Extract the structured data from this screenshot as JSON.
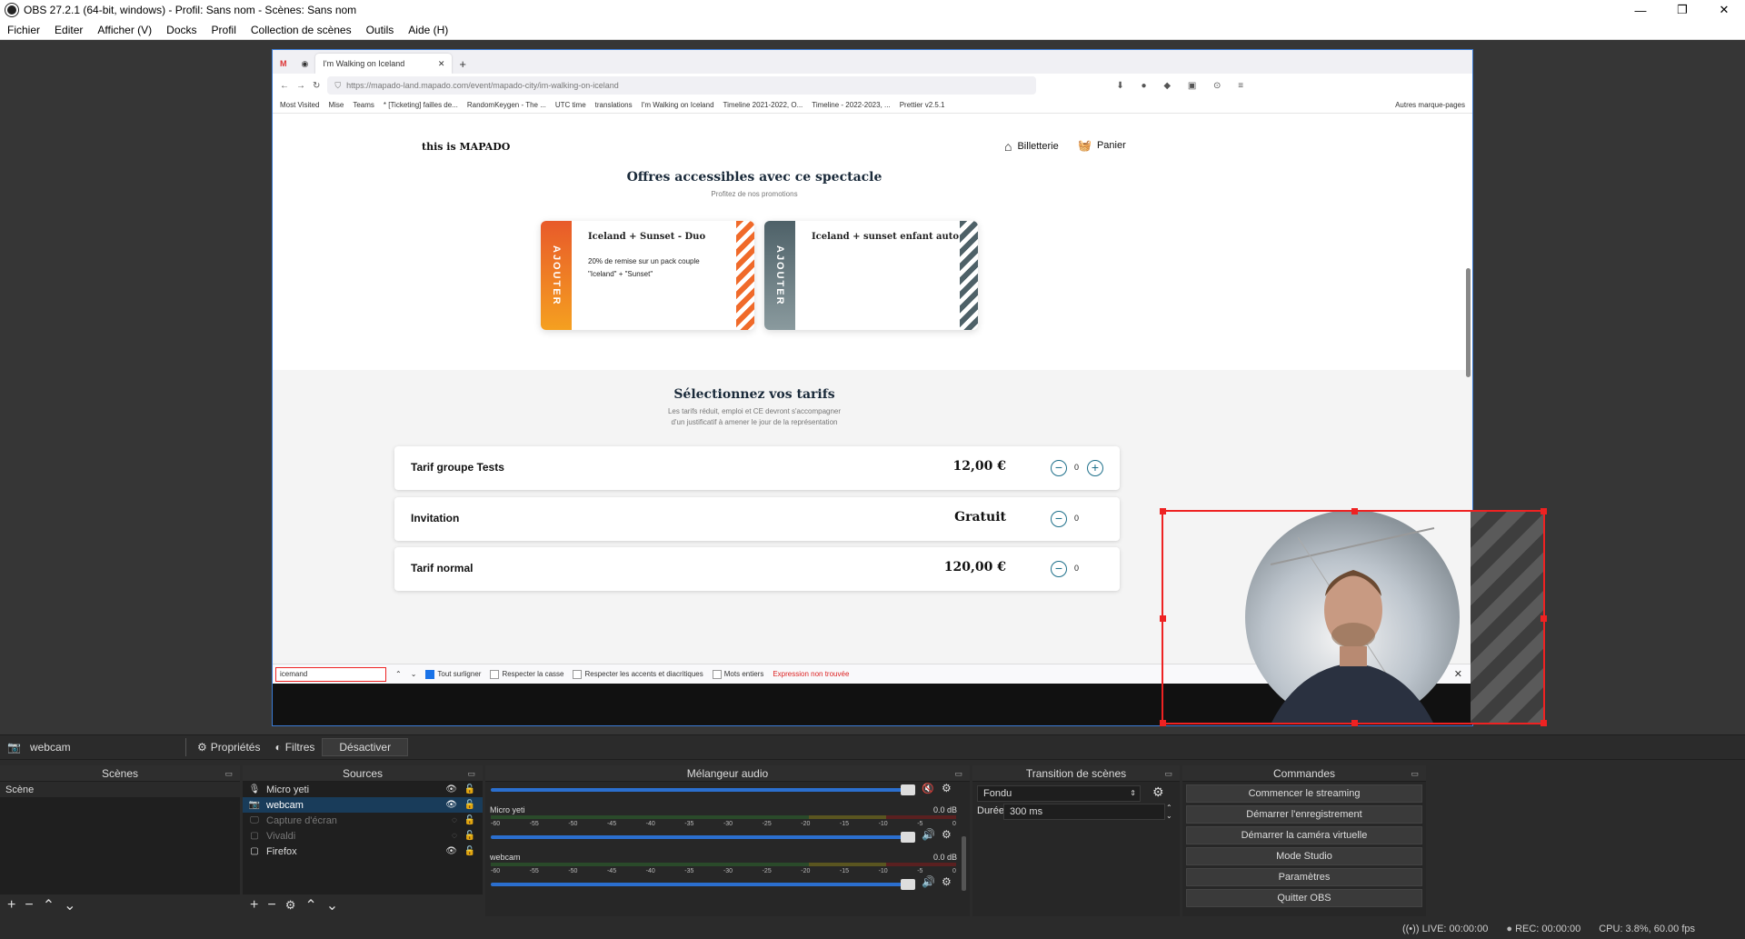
{
  "window": {
    "title": "OBS 27.2.1 (64-bit, windows) - Profil: Sans nom - Scènes: Sans nom"
  },
  "menu": [
    "Fichier",
    "Editer",
    "Afficher (V)",
    "Docks",
    "Profil",
    "Collection de scènes",
    "Outils",
    "Aide (H)"
  ],
  "browser": {
    "tab_title": "I'm Walking on Iceland",
    "url": "https://mapado-land.mapado.com/event/mapado-city/im-walking-on-iceland",
    "bookmarks": [
      "Most Visited",
      "Mise",
      "Teams",
      "* [Ticketing] failles de...",
      "RandomKeygen - The ...",
      "UTC time",
      "translations",
      "I'm Walking on Iceland",
      "Timeline 2021-2022, O...",
      "Timeline - 2022-2023, ...",
      "Prettier v2.5.1"
    ],
    "bookmarks_other": "Autres marque-pages",
    "page": {
      "logo": "this is MAPADO",
      "nav_ticket": "Billetterie",
      "nav_cart": "Panier",
      "offers_title": "Offres accessibles avec ce spectacle",
      "offers_subtitle": "Profitez de nos promotions",
      "offers": [
        {
          "tag": "AJOUTER",
          "title": "Iceland + Sunset - Duo",
          "desc": "20% de remise sur un pack couple \"Iceland\" + \"Sunset\"",
          "color": "#f06a2a"
        },
        {
          "tag": "AJOUTER",
          "title": "Iceland + sunset enfant auto",
          "desc": "",
          "color": "#5a6a70"
        }
      ],
      "tarifs_title": "Sélectionnez vos tarifs",
      "tarifs_subtitle": "Les tarifs réduit, emploi et CE devront s'accompagner d'un justificatif à amener le jour de la représentation",
      "tarifs": [
        {
          "name": "Tarif groupe Tests",
          "price": "12,00 €",
          "qty": "0"
        },
        {
          "name": "Invitation",
          "price": "Gratuit",
          "qty": "0"
        },
        {
          "name": "Tarif normal",
          "price": "120,00 €",
          "qty": "0"
        }
      ]
    },
    "findbar": {
      "query": "icemand",
      "highlight_all": "Tout surligner",
      "match_case": "Respecter la casse",
      "match_diacritics": "Respecter les accents et diacritiques",
      "whole_words": "Mots entiers",
      "status": "Expression non trouvée"
    }
  },
  "source_toolbar": {
    "source_name": "webcam",
    "properties": "Propriétés",
    "filters": "Filtres",
    "deactivate": "Désactiver"
  },
  "docks": {
    "scenes": {
      "title": "Scènes",
      "items": [
        "Scène"
      ]
    },
    "sources": {
      "title": "Sources",
      "items": [
        {
          "name": "Micro yeti",
          "icon": "microphone-icon",
          "visible": true,
          "selected": false,
          "dim": false
        },
        {
          "name": "webcam",
          "icon": "camera-icon",
          "visible": true,
          "selected": true,
          "dim": false
        },
        {
          "name": "Capture d'écran",
          "icon": "monitor-icon",
          "visible": false,
          "selected": false,
          "dim": true
        },
        {
          "name": "Vivaldi",
          "icon": "window-icon",
          "visible": false,
          "selected": false,
          "dim": true
        },
        {
          "name": "Firefox",
          "icon": "window-icon",
          "visible": true,
          "selected": false,
          "dim": false
        }
      ]
    },
    "mixer": {
      "title": "Mélangeur audio",
      "channels": [
        {
          "name": "Micro yeti",
          "db": "0.0 dB"
        },
        {
          "name": "webcam",
          "db": "0.0 dB"
        }
      ],
      "ticks": [
        "-60",
        "-55",
        "-50",
        "-45",
        "-40",
        "-35",
        "-30",
        "-25",
        "-20",
        "-15",
        "-10",
        "-5",
        "0"
      ]
    },
    "transitions": {
      "title": "Transition de scènes",
      "transition": "Fondu",
      "duration_label": "Durée",
      "duration": "300 ms"
    },
    "commands": {
      "title": "Commandes",
      "buttons": [
        "Commencer le streaming",
        "Démarrer l'enregistrement",
        "Démarrer la caméra virtuelle",
        "Mode Studio",
        "Paramètres",
        "Quitter OBS"
      ]
    }
  },
  "status": {
    "live": "LIVE: 00:00:00",
    "rec": "REC: 00:00:00",
    "cpu": "CPU: 3.8%, 60.00 fps"
  }
}
